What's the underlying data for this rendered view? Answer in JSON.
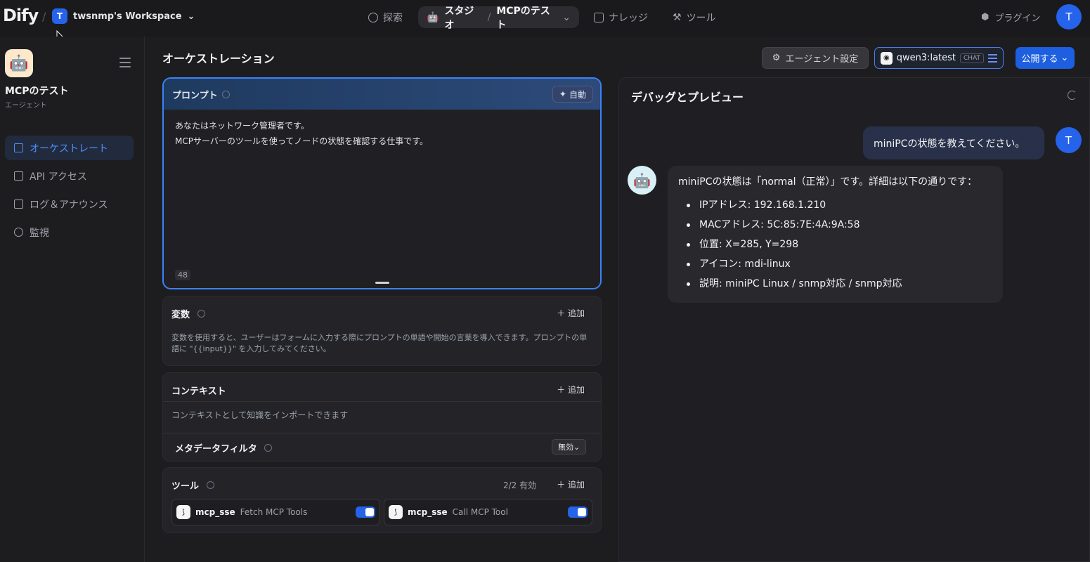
{
  "header": {
    "logo": "Dify",
    "workspace_initial": "T",
    "workspace_name": "twsnmp's Workspace",
    "nav": {
      "explore": "探索",
      "studio": "スタジオ",
      "app_name": "MCPのテスト",
      "knowledge": "ナレッジ",
      "tools": "ツール"
    },
    "plugins": "プラグイン",
    "user_initial": "T"
  },
  "sidebar": {
    "app_name": "MCPのテスト",
    "app_type": "エージェント",
    "items": [
      {
        "label": "オーケストレート",
        "active": true
      },
      {
        "label": "API アクセス",
        "active": false
      },
      {
        "label": "ログ＆アナウンス",
        "active": false
      },
      {
        "label": "監視",
        "active": false
      }
    ]
  },
  "orchestration": {
    "title": "オーケストレーション",
    "agent_settings": "エージェント設定",
    "model_name": "qwen3:latest",
    "model_tag": "CHAT",
    "publish": "公開する",
    "prompt": {
      "title": "プロンプト",
      "auto": "自動",
      "line1": "あなたはネットワーク管理者です。",
      "line2": "MCPサーバーのツールを使ってノードの状態を確認する仕事です。",
      "char_count": "48"
    },
    "variables": {
      "title": "変数",
      "add": "追加",
      "desc": "変数を使用すると、ユーザーはフォームに入力する際にプロンプトの単語や開始の言葉を導入できます。プロンプトの単語に \"{{input}}\" を入力してみてください。"
    },
    "context": {
      "title": "コンテキスト",
      "add": "追加",
      "desc": "コンテキストとして知識をインポートできます",
      "metadata_label": "メタデータフィルタ",
      "metadata_value": "無効"
    },
    "tools": {
      "title": "ツール",
      "count": "2/2 有効",
      "add": "追加",
      "items": [
        {
          "provider": "mcp_sse",
          "name": "Fetch MCP Tools",
          "enabled": true
        },
        {
          "provider": "mcp_sse",
          "name": "Call MCP Tool",
          "enabled": true
        }
      ]
    }
  },
  "debug": {
    "title": "デバッグとプレビュー",
    "user_initial": "T",
    "user_message": "miniPCの状態を教えてください。",
    "bot_lead": "miniPCの状態は「normal（正常）」です。詳細は以下の通りです：",
    "bot_items": [
      "IPアドレス: 192.168.1.210",
      "MACアドレス: 5C:85:7E:4A:9A:58",
      "位置: X=285, Y=298",
      "アイコン: mdi-linux",
      "説明: miniPC Linux / snmp対応 / snmp対応"
    ]
  }
}
